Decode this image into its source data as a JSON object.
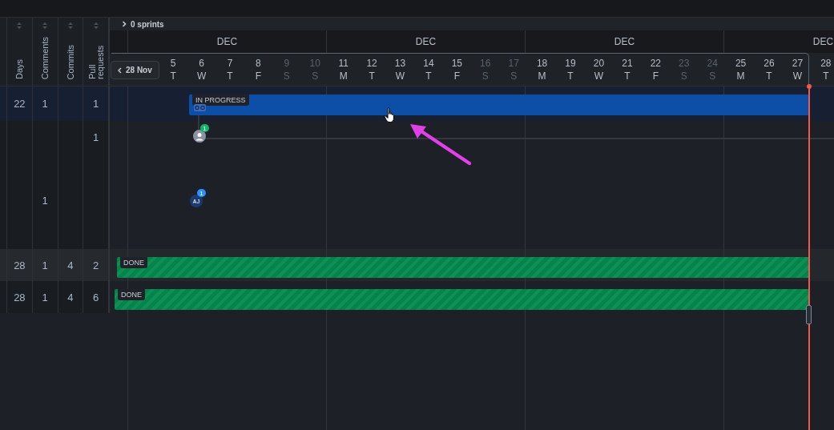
{
  "sprints": {
    "label": "0 sprints",
    "expanded": false
  },
  "columns": [
    {
      "label": "Days"
    },
    {
      "label": "Comments"
    },
    {
      "label": "Commits"
    },
    {
      "label": "Pull requests"
    }
  ],
  "back_button": "28 Nov",
  "months": [
    "DEC",
    "DEC",
    "DEC",
    "DEC"
  ],
  "days": [
    {
      "date": "5",
      "weekday": "T",
      "weekend": false
    },
    {
      "date": "6",
      "weekday": "W",
      "weekend": false
    },
    {
      "date": "7",
      "weekday": "T",
      "weekend": false
    },
    {
      "date": "8",
      "weekday": "F",
      "weekend": false
    },
    {
      "date": "9",
      "weekday": "S",
      "weekend": true
    },
    {
      "date": "10",
      "weekday": "S",
      "weekend": true
    },
    {
      "date": "11",
      "weekday": "M",
      "weekend": false
    },
    {
      "date": "12",
      "weekday": "T",
      "weekend": false
    },
    {
      "date": "13",
      "weekday": "W",
      "weekend": false
    },
    {
      "date": "14",
      "weekday": "T",
      "weekend": false
    },
    {
      "date": "15",
      "weekday": "F",
      "weekend": false
    },
    {
      "date": "16",
      "weekday": "S",
      "weekend": true
    },
    {
      "date": "17",
      "weekday": "S",
      "weekend": true
    },
    {
      "date": "18",
      "weekday": "M",
      "weekend": false
    },
    {
      "date": "19",
      "weekday": "T",
      "weekend": false
    },
    {
      "date": "20",
      "weekday": "W",
      "weekend": false
    },
    {
      "date": "21",
      "weekday": "T",
      "weekend": false
    },
    {
      "date": "22",
      "weekday": "F",
      "weekend": false
    },
    {
      "date": "23",
      "weekday": "S",
      "weekend": true
    },
    {
      "date": "24",
      "weekday": "S",
      "weekend": true
    },
    {
      "date": "25",
      "weekday": "M",
      "weekend": false
    },
    {
      "date": "26",
      "weekday": "T",
      "weekend": false
    },
    {
      "date": "27",
      "weekday": "W",
      "weekend": false
    },
    {
      "date": "28",
      "weekday": "T",
      "weekend": false
    }
  ],
  "rows": [
    {
      "kind": "bar",
      "selected": true,
      "hovered": false,
      "cells": [
        "22",
        "1",
        "",
        "1"
      ],
      "bar": {
        "status": "IN PROGRESS",
        "kind": "in_progress",
        "linked": true
      }
    },
    {
      "kind": "avatar",
      "selected": false,
      "hovered": false,
      "cells": [
        "",
        "",
        "",
        "1"
      ],
      "avatar": {
        "kind": "person",
        "badge": "1",
        "color": "#17b26a"
      }
    },
    {
      "kind": "avatar",
      "selected": false,
      "hovered": false,
      "cells": [
        "",
        "1",
        "",
        ""
      ],
      "avatar": {
        "kind": "initials",
        "initials": "AJ",
        "badge": "1",
        "color": "#2e90fa"
      }
    },
    {
      "kind": "bar",
      "selected": false,
      "hovered": true,
      "cells": [
        "28",
        "1",
        "4",
        "2"
      ],
      "bar": {
        "status": "DONE",
        "kind": "done",
        "linked": false
      }
    },
    {
      "kind": "bar",
      "selected": false,
      "hovered": false,
      "cells": [
        "28",
        "1",
        "4",
        "6"
      ],
      "bar": {
        "status": "DONE",
        "kind": "done",
        "linked": false
      }
    }
  ]
}
